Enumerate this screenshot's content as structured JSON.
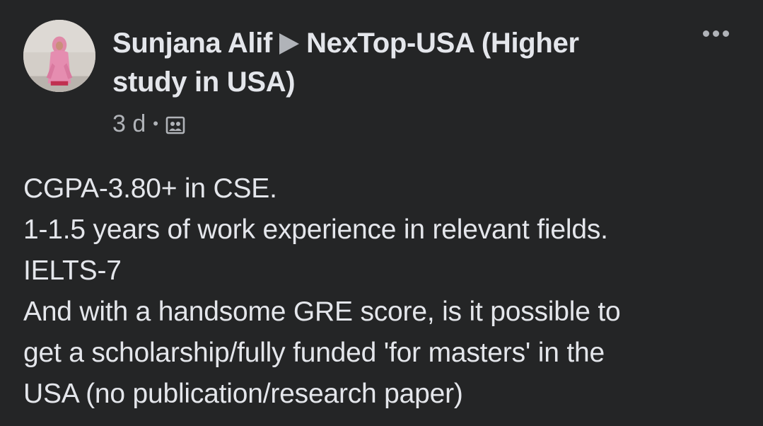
{
  "post": {
    "author": "Sunjana Alif",
    "group_name": "NexTop-USA (Higher study in USA)",
    "timestamp": "3 d",
    "separator": "•",
    "privacy_icon": "group-icon",
    "more_icon": "more-horizontal-icon",
    "lines": [
      "CGPA-3.80+ in CSE.",
      "1-1.5 years of work experience in relevant fields.",
      "IELTS-7",
      "And with a handsome GRE score, is it possible to",
      "get a scholarship/fully funded 'for masters' in the",
      "USA (no publication/research paper)"
    ]
  },
  "colors": {
    "background": "#242526",
    "primary_text": "#e4e6eb",
    "secondary_text": "#b0b3b8"
  }
}
